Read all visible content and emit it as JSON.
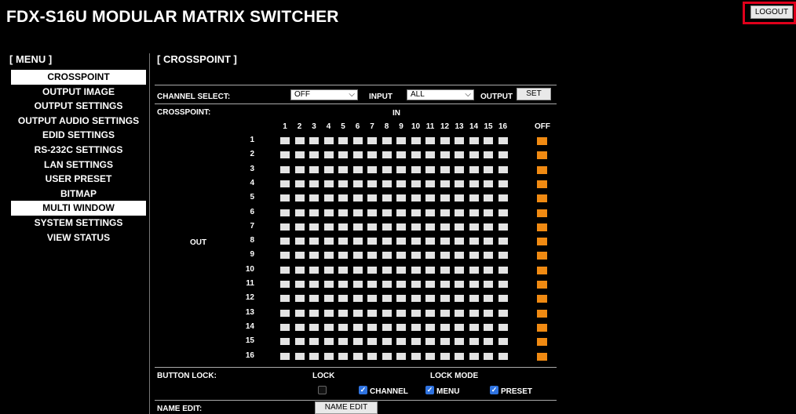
{
  "header": {
    "title": "FDX-S16U MODULAR MATRIX SWITCHER",
    "logout_label": "LOGOUT"
  },
  "menu": {
    "heading": "[ MENU ]",
    "items": [
      {
        "label": "CROSSPOINT",
        "active": true
      },
      {
        "label": "OUTPUT IMAGE",
        "active": false
      },
      {
        "label": "OUTPUT SETTINGS",
        "active": false
      },
      {
        "label": "OUTPUT AUDIO SETTINGS",
        "active": false
      },
      {
        "label": "EDID SETTINGS",
        "active": false
      },
      {
        "label": "RS-232C SETTINGS",
        "active": false
      },
      {
        "label": "LAN SETTINGS",
        "active": false
      },
      {
        "label": "USER PRESET",
        "active": false
      },
      {
        "label": "BITMAP",
        "active": false
      },
      {
        "label": "MULTI WINDOW",
        "active": true
      },
      {
        "label": "SYSTEM SETTINGS",
        "active": false
      },
      {
        "label": "VIEW STATUS",
        "active": false
      }
    ]
  },
  "crosspoint": {
    "heading": "[ CROSSPOINT ]",
    "channel_select": {
      "label": "CHANNEL SELECT:",
      "value": "OFF"
    },
    "input": {
      "label": "INPUT",
      "value": "ALL"
    },
    "output": {
      "label": "OUTPUT",
      "set_label": "SET"
    },
    "grid_label": "CROSSPOINT:",
    "in_label": "IN",
    "out_label": "OUT",
    "off_label": "OFF",
    "inputs": [
      "1",
      "2",
      "3",
      "4",
      "5",
      "6",
      "7",
      "8",
      "9",
      "10",
      "11",
      "12",
      "13",
      "14",
      "15",
      "16"
    ],
    "outputs": [
      "1",
      "2",
      "3",
      "4",
      "5",
      "6",
      "7",
      "8",
      "9",
      "10",
      "11",
      "12",
      "13",
      "14",
      "15",
      "16"
    ],
    "active_color": "#f08a12"
  },
  "button_lock": {
    "label": "BUTTON LOCK:",
    "lock_label": "LOCK",
    "lock_checked": false,
    "lock_mode_label": "LOCK MODE",
    "channel": {
      "label": "CHANNEL",
      "checked": true
    },
    "menu": {
      "label": "MENU",
      "checked": true
    },
    "preset": {
      "label": "PRESET",
      "checked": true
    }
  },
  "name_edit": {
    "label": "NAME EDIT:",
    "button_label": "NAME EDIT"
  }
}
